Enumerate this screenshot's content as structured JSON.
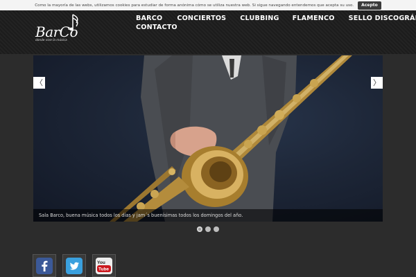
{
  "cookie": {
    "text": "Como la mayoría de las webs, utilizamos cookies para estudiar de forma anónima cómo se utiliza nuestra web. Si sigue navegando entendemos que acepta su uso.",
    "accept_label": "Acepto"
  },
  "logo": {
    "wordmark": "BarCo",
    "tagline": "donde vive la música"
  },
  "nav": {
    "items": [
      {
        "label": "BARCO"
      },
      {
        "label": "CONCIERTOS"
      },
      {
        "label": "CLUBBING"
      },
      {
        "label": "FLAMENCO"
      },
      {
        "label": "SELLO DISCOGRÁFICO"
      },
      {
        "label": "CONTACTO"
      }
    ]
  },
  "slider": {
    "caption": "Sala Barco, buena música todos los días y jam´s buenísimas todos los domingos del año.",
    "prev_arrow": "〈",
    "next_arrow": "〉",
    "slide_count": 3,
    "active_slide": 1
  },
  "social": [
    {
      "icon": "facebook-icon"
    },
    {
      "icon": "twitter-icon"
    },
    {
      "icon": "youtube-icon"
    }
  ],
  "colors": {
    "page_bg": "#2c2c2c",
    "header_bg": "#1f1f1f",
    "cookie_bg": "#f4f4f4",
    "facebook": "#3b5998",
    "twitter": "#3aa0de",
    "youtube": "#cc181e"
  }
}
